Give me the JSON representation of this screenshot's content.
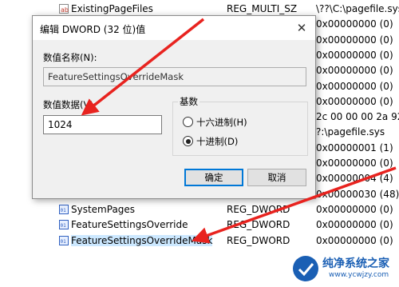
{
  "registry": {
    "rows": [
      {
        "name": "ExistingPageFiles",
        "type": "REG_MULTI_SZ",
        "data": "\\??\\C:\\pagefile.sys",
        "kind": "sz"
      },
      {
        "name": "",
        "type": "",
        "data": "0x00000000 (0)",
        "kind": "bin"
      },
      {
        "name": "",
        "type": "",
        "data": "0x00000000 (0)",
        "kind": "bin"
      },
      {
        "name": "",
        "type": "",
        "data": "0x00000000 (0)",
        "kind": "bin"
      },
      {
        "name": "",
        "type": "",
        "data": "0x00000000 (0)",
        "kind": "bin"
      },
      {
        "name": "",
        "type": "",
        "data": "0x00000000 (0)",
        "kind": "bin"
      },
      {
        "name": "",
        "type": "",
        "data": "0x00000000 (0)",
        "kind": "bin"
      },
      {
        "name": "",
        "type": "",
        "data": "2c 00 00 00 2a 92 00",
        "kind": "bin"
      },
      {
        "name": "",
        "type": "",
        "data": "?:\\pagefile.sys",
        "kind": "sz"
      },
      {
        "name": "",
        "type": "",
        "data": "0x00000001 (1)",
        "kind": "bin"
      },
      {
        "name": "",
        "type": "",
        "data": "0x00000000 (0)",
        "kind": "bin"
      },
      {
        "name": "",
        "type": "",
        "data": "0x00000004 (4)",
        "kind": "bin"
      },
      {
        "name": "",
        "type": "",
        "data": "0x00000030 (48)",
        "kind": "bin"
      },
      {
        "name": "SystemPages",
        "type": "REG_DWORD",
        "data": "0x00000000 (0)",
        "kind": "bin"
      },
      {
        "name": "FeatureSettingsOverride",
        "type": "REG_DWORD",
        "data": "0x00000000 (0)",
        "kind": "bin"
      },
      {
        "name": "FeatureSettingsOverrideMask",
        "type": "REG_DWORD",
        "data": "0x00000000 (0)",
        "kind": "bin",
        "selected": true
      }
    ]
  },
  "dialog": {
    "title": "编辑 DWORD (32 位)值",
    "close_glyph": "✕",
    "value_name_label": "数值名称(N):",
    "value_name": "FeatureSettingsOverrideMask",
    "value_data_label": "数值数据(V):",
    "value_data": "1024",
    "base_label": "基数",
    "hex_label": "十六进制(H)",
    "dec_label": "十进制(D)",
    "selected_base": "decimal",
    "ok_label": "确定",
    "cancel_label": "取消"
  },
  "watermark": {
    "text": "纯净系统之家",
    "url": "www.ycwjzy.com"
  },
  "colors": {
    "arrow": "#e8231f",
    "accent": "#0078d7",
    "watermark": "#1a5fb4"
  }
}
